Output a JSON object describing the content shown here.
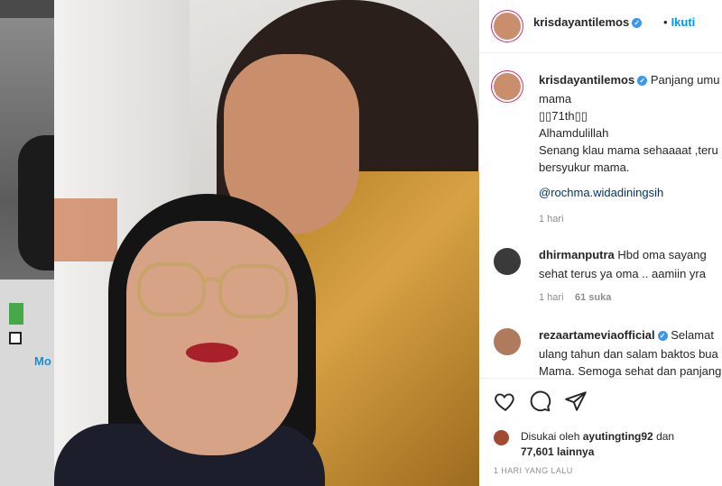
{
  "post": {
    "username": "krisdayantilemos",
    "follow_label": "Ikuti",
    "caption": {
      "line1": "Panjang umu",
      "line2": "mama",
      "line3": "▯▯71th▯▯",
      "line4": "Alhamdulillah",
      "line5": "Senang klau mama sehaaaat ,teru",
      "line6": "bersyukur mama.",
      "mention": "@rochma.widadiningsih",
      "time": "1 hari"
    }
  },
  "comments": [
    {
      "username": "dhirmanputra",
      "line1": "Hbd oma sayang",
      "line2": "sehat terus ya oma .. aamiin yra",
      "time": "1 hari",
      "likes": "61 suka"
    },
    {
      "username": "rezaartameviaofficial",
      "line1": "Selamat",
      "line2": "ulang tahun dan salam baktos bua",
      "line3": "Mama. Semoga sehat dan panjang"
    }
  ],
  "likes": {
    "prefix": "Disukai oleh",
    "user": "ayutingting92",
    "joiner": "dan",
    "count": "77,601 lainnya"
  },
  "date": "1 HARI YANG LALU",
  "backdrop": {
    "text": "Mo"
  },
  "colors": {
    "link": "#0095f6",
    "verified": "#3897f0",
    "text": "#262626",
    "muted": "#8e8e8e"
  }
}
